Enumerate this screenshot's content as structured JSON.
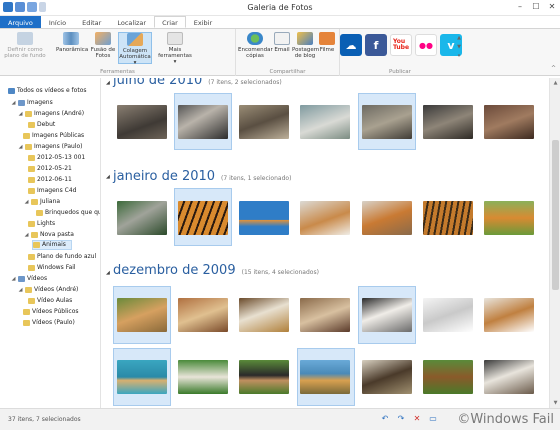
{
  "window": {
    "title": "Galeria de Fotos",
    "min": "–",
    "max": "☐",
    "close": "✕"
  },
  "tabs": [
    {
      "label": "Arquivo"
    },
    {
      "label": "Início"
    },
    {
      "label": "Editar"
    },
    {
      "label": "Localizar"
    },
    {
      "label": "Criar"
    },
    {
      "label": "Exibir"
    }
  ],
  "ribbon": {
    "ferramentas": {
      "label": "Ferramentas",
      "definir": "Definir como plano de fundo",
      "panoramica": "Panorâmica",
      "fusao": "Fusão de Fotos",
      "colagem": "Colagem Automática ▾",
      "mais": "Mais ferramentas ▾"
    },
    "compartilhar": {
      "label": "Compartilhar",
      "encomendar": "Encomendar cópias",
      "email": "Email",
      "postagem": "Postagem de blog",
      "filme": "Filme"
    },
    "publicar": {
      "label": "Publicar",
      "onedrive": "☁",
      "facebook": "f",
      "youtube": "You\nTube",
      "flickr": "●●",
      "vimeo": "v"
    }
  },
  "nav": {
    "all": "Todos os vídeos e fotos",
    "imagens": "Imagens",
    "imagens_andre": "Imagens (André)",
    "debut": "Debut",
    "imagens_publicas": "Imagens Públicas",
    "imagens_paulo": "Imagens (Paulo)",
    "d1": "2012-05-13 001",
    "d2": "2012-05-21",
    "d3": "2012-06-11",
    "c4d": "Imagens C4d",
    "juliana": "Juliana",
    "brinquedos": "Brinquedos que que",
    "lights": "Lights",
    "nova_pasta": "Nova pasta",
    "animais": "Animais",
    "plano_azul": "Plano de fundo azul",
    "windows_fail": "Windows Fail",
    "videos": "Vídeos",
    "videos_andre": "Vídeos (André)",
    "video_aulas": "Vídeo Aulas",
    "videos_publicos": "Vídeos Públicos",
    "videos_paulo": "Vídeos (Paulo)"
  },
  "groups": [
    {
      "title": "julho de 2010",
      "count": "(7 itens, 2 selecionados)"
    },
    {
      "title": "janeiro de 2010",
      "count": "(7 itens, 1 selecionado)"
    },
    {
      "title": "dezembro de 2009",
      "count": "(15 itens, 4 selecionados)"
    }
  ],
  "status": {
    "text": "37 itens, 7 selecionados",
    "watermark": "©Windows Fail"
  },
  "colors": {
    "file_tab": "#1e6fc8",
    "group_title": "#2a5fa0",
    "selection": "#d7e8f9",
    "facebook": "#3b5998",
    "youtube": "#e62117",
    "vimeo": "#1ab7ea",
    "onedrive": "#0a5fb4"
  }
}
